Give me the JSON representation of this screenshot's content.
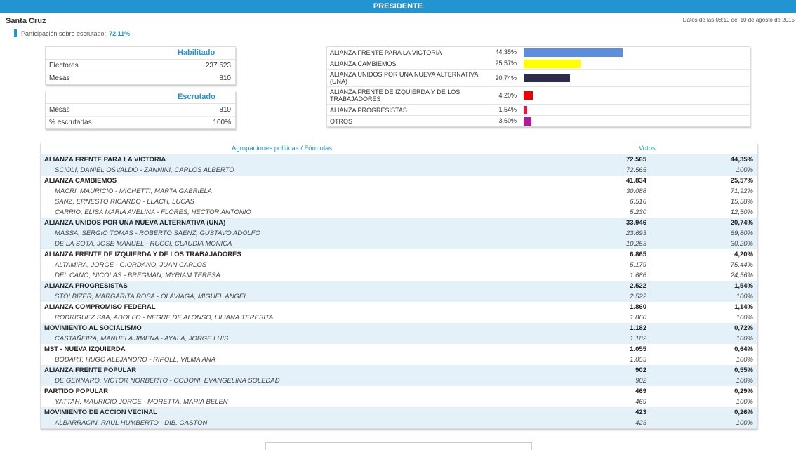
{
  "header": {
    "title": "PRESIDENTE"
  },
  "region": "Santa Cruz",
  "date_text": "Datos de las 08:10 del 10 de agosto de 2015",
  "participation": {
    "label": "Participación sobre escrutado:",
    "value": "72,11%"
  },
  "habilitado": {
    "title": "Habilitado",
    "rows": [
      {
        "label": "Electores",
        "value": "237.523"
      },
      {
        "label": "Mesas",
        "value": "810"
      }
    ]
  },
  "escrutado": {
    "title": "Escrutado",
    "rows": [
      {
        "label": "Mesas",
        "value": "810"
      },
      {
        "label": "% escrutadas",
        "value": "100%"
      }
    ]
  },
  "bars": [
    {
      "name": "ALIANZA FRENTE PARA LA VICTORIA",
      "pct": "44,35%",
      "value": 44.35,
      "color": "#5b8fdd"
    },
    {
      "name": "ALIANZA CAMBIEMOS",
      "pct": "25,57%",
      "value": 25.57,
      "color": "#ffff00"
    },
    {
      "name": "ALIANZA UNIDOS POR UNA NUEVA ALTERNATIVA (UNA)",
      "pct": "20,74%",
      "value": 20.74,
      "color": "#2b2d4a"
    },
    {
      "name": "ALIANZA FRENTE DE IZQUIERDA Y DE LOS TRABAJADORES",
      "pct": "4,20%",
      "value": 4.2,
      "color": "#ee0000"
    },
    {
      "name": "ALIANZA PROGRESISTAS",
      "pct": "1,54%",
      "value": 1.54,
      "color": "#ee1144"
    },
    {
      "name": "OTROS",
      "pct": "3,60%",
      "value": 3.6,
      "color": "#b01a9a"
    }
  ],
  "table": {
    "col_parties": "Agrupaciones políticas / Fórmulas",
    "col_votes": "Votos",
    "rows": [
      {
        "type": "party",
        "name": "ALIANZA FRENTE PARA LA VICTORIA",
        "votes": "72.565",
        "pct": "44,35%"
      },
      {
        "type": "cand",
        "name": "SCIOLI, DANIEL OSVALDO - ZANNINI, CARLOS ALBERTO",
        "votes": "72.565",
        "pct": "100%"
      },
      {
        "type": "party",
        "name": "ALIANZA CAMBIEMOS",
        "votes": "41.834",
        "pct": "25,57%"
      },
      {
        "type": "cand",
        "name": "MACRI, MAURICIO - MICHETTI, MARTA GABRIELA",
        "votes": "30.088",
        "pct": "71,92%"
      },
      {
        "type": "cand",
        "name": "SANZ, ERNESTO RICARDO - LLACH, LUCAS",
        "votes": "6.516",
        "pct": "15,58%"
      },
      {
        "type": "cand",
        "name": "CARRIO, ELISA MARIA AVELINA - FLORES, HECTOR ANTONIO",
        "votes": "5.230",
        "pct": "12,50%"
      },
      {
        "type": "party",
        "name": "ALIANZA UNIDOS POR UNA NUEVA ALTERNATIVA (UNA)",
        "votes": "33.946",
        "pct": "20,74%"
      },
      {
        "type": "cand",
        "name": "MASSA, SERGIO TOMAS - ROBERTO SAENZ, GUSTAVO ADOLFO",
        "votes": "23.693",
        "pct": "69,80%"
      },
      {
        "type": "cand",
        "name": "DE LA SOTA, JOSE MANUEL - RUCCI, CLAUDIA MONICA",
        "votes": "10.253",
        "pct": "30,20%"
      },
      {
        "type": "party",
        "name": "ALIANZA FRENTE DE IZQUIERDA Y DE LOS TRABAJADORES",
        "votes": "6.865",
        "pct": "4,20%"
      },
      {
        "type": "cand",
        "name": "ALTAMIRA, JORGE - GIORDANO, JUAN CARLOS",
        "votes": "5.179",
        "pct": "75,44%"
      },
      {
        "type": "cand",
        "name": "DEL CAÑO, NICOLAS - BREGMAN, MYRIAM TERESA",
        "votes": "1.686",
        "pct": "24,56%"
      },
      {
        "type": "party",
        "name": "ALIANZA PROGRESISTAS",
        "votes": "2.522",
        "pct": "1,54%"
      },
      {
        "type": "cand",
        "name": "STOLBIZER, MARGARITA ROSA - OLAVIAGA, MIGUEL ANGEL",
        "votes": "2.522",
        "pct": "100%"
      },
      {
        "type": "party",
        "name": "ALIANZA COMPROMISO FEDERAL",
        "votes": "1.860",
        "pct": "1,14%"
      },
      {
        "type": "cand",
        "name": "RODRIGUEZ SAA, ADOLFO - NEGRE DE ALONSO, LILIANA TERESITA",
        "votes": "1.860",
        "pct": "100%"
      },
      {
        "type": "party",
        "name": "MOVIMIENTO AL SOCIALISMO",
        "votes": "1.182",
        "pct": "0,72%"
      },
      {
        "type": "cand",
        "name": "CASTAÑEIRA, MANUELA JIMENA - AYALA, JORGE LUIS",
        "votes": "1.182",
        "pct": "100%"
      },
      {
        "type": "party",
        "name": "MST - NUEVA IZQUIERDA",
        "votes": "1.055",
        "pct": "0,64%"
      },
      {
        "type": "cand",
        "name": "BODART, HUGO ALEJANDRO - RIPOLL, VILMA ANA",
        "votes": "1.055",
        "pct": "100%"
      },
      {
        "type": "party",
        "name": "ALIANZA FRENTE POPULAR",
        "votes": "902",
        "pct": "0,55%"
      },
      {
        "type": "cand",
        "name": "DE GENNARO, VICTOR NORBERTO - CODONI, EVANGELINA SOLEDAD",
        "votes": "902",
        "pct": "100%"
      },
      {
        "type": "party",
        "name": "PARTIDO POPULAR",
        "votes": "469",
        "pct": "0,29%"
      },
      {
        "type": "cand",
        "name": "YATTAH, MAURICIO JORGE - MORETTA, MARIA BELEN",
        "votes": "469",
        "pct": "100%"
      },
      {
        "type": "party",
        "name": "MOVIMIENTO DE ACCION VECINAL",
        "votes": "423",
        "pct": "0,26%"
      },
      {
        "type": "cand",
        "name": "ALBARRACIN, RAUL HUMBERTO - DIB, GASTON",
        "votes": "423",
        "pct": "100%"
      }
    ]
  }
}
